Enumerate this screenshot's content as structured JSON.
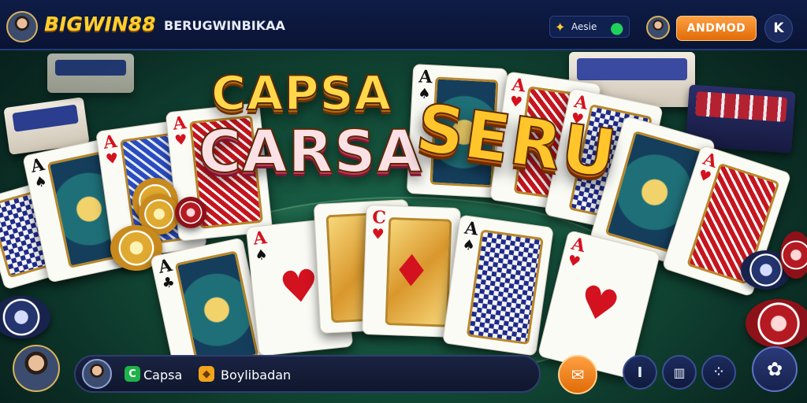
{
  "header": {
    "brand": "BIGWIN88",
    "subtitle": "BERUGWINBIKAA",
    "coin_label": "Aesie",
    "action_button": "ANDMOD",
    "close_glyph": "K"
  },
  "title_art": {
    "line1": "CAPSA",
    "line2": "CARSA",
    "line3": "SERU"
  },
  "cards": [
    {
      "rank": "A",
      "suit": "♠",
      "color": "blk"
    },
    {
      "rank": "A",
      "suit": "♥",
      "color": "red"
    },
    {
      "rank": "A",
      "suit": "♠",
      "color": "blk"
    },
    {
      "rank": "A",
      "suit": "♥",
      "color": "red"
    },
    {
      "rank": "A",
      "suit": "♥",
      "color": "red"
    },
    {
      "rank": "A",
      "suit": "♣",
      "color": "blk"
    },
    {
      "rank": "A",
      "suit": "♠",
      "color": "blk"
    },
    {
      "rank": "C",
      "suit": "♦",
      "color": "red"
    },
    {
      "rank": "A",
      "suit": "♠",
      "color": "blk"
    },
    {
      "rank": "A",
      "suit": "♥",
      "color": "red"
    },
    {
      "rank": "A",
      "suit": "♥",
      "color": "red"
    },
    {
      "rank": "A",
      "suit": "♥",
      "color": "red"
    }
  ],
  "bottom": {
    "item1": "Capsa",
    "item2": "Boylibadan",
    "info_glyph": "I"
  },
  "colors": {
    "accent_gold": "#ffcf2e",
    "button_orange": "#f08a1e",
    "felt_green": "#114634",
    "bar_navy": "#0a1434"
  },
  "icons": [
    "gold-coin-icon",
    "green-gem-icon",
    "close-icon",
    "capsa-tag-icon",
    "boylibadan-tag-icon",
    "gift-icon",
    "info-icon",
    "book-icon",
    "dots-icon",
    "settings-icon"
  ]
}
